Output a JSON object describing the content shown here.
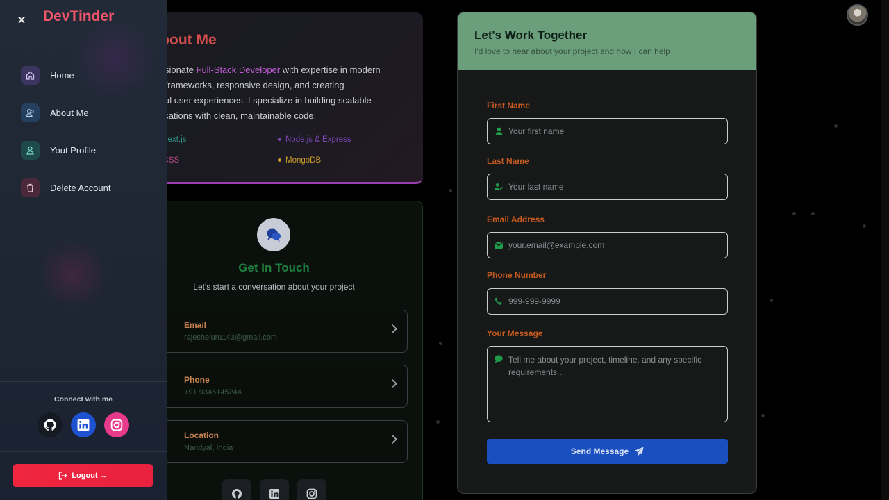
{
  "about": {
    "title": "About Me",
    "text_pre": "passionate ",
    "text_highlight": "Full-Stack Developer",
    "text_post": " with expertise in modern",
    "line2": "ript frameworks, responsive design, and creating",
    "line3": "tional user experiences. I specialize in building scalable",
    "line4": "pplications with clean, maintainable code.",
    "skills": [
      {
        "label": "t & Next.js",
        "color": "#2e9a8a"
      },
      {
        "label": "Node.js & Express",
        "color": "#7b47b8"
      },
      {
        "label": "ind CSS",
        "color": "#b84a86"
      },
      {
        "label": "MongoDB",
        "color": "#c79a2a"
      }
    ]
  },
  "contact": {
    "title": "Get In Touch",
    "subtitle": "Let's start a conversation about your project",
    "items": [
      {
        "label": "Email",
        "value": "rajesheluru143@gmail.com"
      },
      {
        "label": "Phone",
        "value": "+91 9346145244"
      },
      {
        "label": "Location",
        "value": "Nandyal, India"
      }
    ],
    "socials": [
      "github-icon",
      "linkedin-icon",
      "instagram-icon"
    ]
  },
  "form": {
    "title": "Let's Work Together",
    "subtitle": "I'd love to hear about your project and how I can help",
    "first_name_label": "First Name",
    "first_name_placeholder": "Your first name",
    "last_name_label": "Last Name",
    "last_name_placeholder": "Your last name",
    "email_label": "Email Address",
    "email_placeholder": "your.email@example.com",
    "phone_label": "Phone Number",
    "phone_placeholder": "999-999-9999",
    "message_label": "Your Message",
    "message_placeholder": "Tell me about your project, timeline, and any specific requirements...",
    "send_label": "Send Message"
  },
  "sidebar": {
    "close": "✕",
    "brand": "DevTinder",
    "items": [
      {
        "label": "Home",
        "icon": "home-icon"
      },
      {
        "label": "About Me",
        "icon": "users-icon"
      },
      {
        "label": "Yout Profile",
        "icon": "user-icon"
      },
      {
        "label": "Delete Account",
        "icon": "trash-icon"
      }
    ],
    "connect": "Connect with me",
    "logout": "Logout →"
  },
  "colors": {
    "brand": "#f0566a",
    "accent": "#1a4fc0",
    "logout": "#f0263f",
    "form_header": "#6b9e7b",
    "label_orange": "#c65a1f",
    "contact_green": "#1f7f3e"
  }
}
